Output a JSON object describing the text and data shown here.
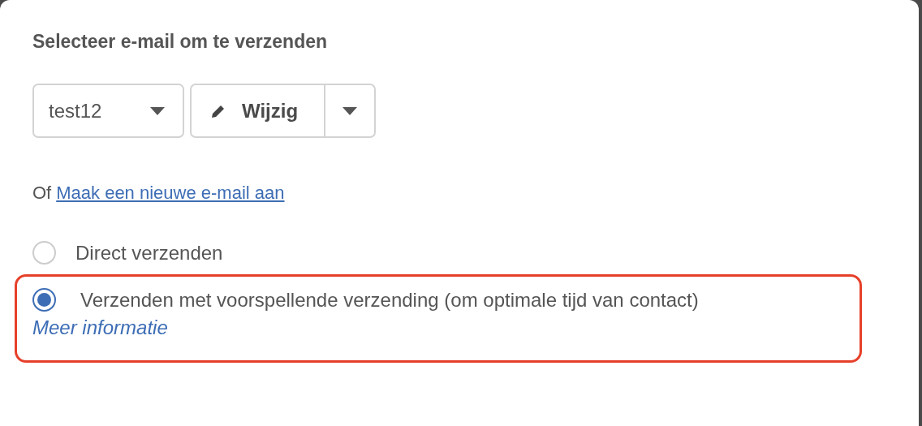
{
  "heading": "Selecteer e-mail om te verzenden",
  "email_select": {
    "value": "test12"
  },
  "edit_button": {
    "label": "Wijzig"
  },
  "create_line": {
    "prefix": "Of",
    "link": "Maak een nieuwe e-mail aan"
  },
  "send_options": [
    {
      "label": "Direct verzenden",
      "selected": false,
      "highlighted": false
    },
    {
      "label": "Verzenden met voorspellende verzending (om optimale tijd van contact)",
      "selected": true,
      "highlighted": true,
      "link": "Meer informatie"
    }
  ]
}
